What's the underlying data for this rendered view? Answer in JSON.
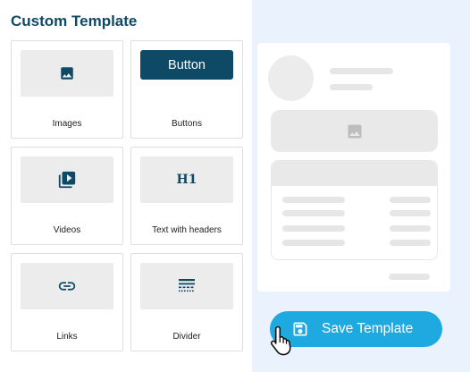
{
  "panel": {
    "title": "Custom Template"
  },
  "blocks": [
    {
      "label": "Images",
      "icon": "image-icon"
    },
    {
      "label": "Buttons",
      "icon": "button-preview",
      "preview_text": "Button"
    },
    {
      "label": "Videos",
      "icon": "video-library-icon"
    },
    {
      "label": "Text with headers",
      "icon": "heading-icon",
      "preview_text": "H1"
    },
    {
      "label": "Links",
      "icon": "link-icon"
    },
    {
      "label": "Divider",
      "icon": "divider-icon"
    }
  ],
  "actions": {
    "save_label": "Save Template",
    "save_icon": "floppy-disk-icon"
  },
  "colors": {
    "accent_dark": "#0e4a66",
    "accent_blue": "#1ea9e0",
    "preview_bg": "#eaf2fd"
  }
}
